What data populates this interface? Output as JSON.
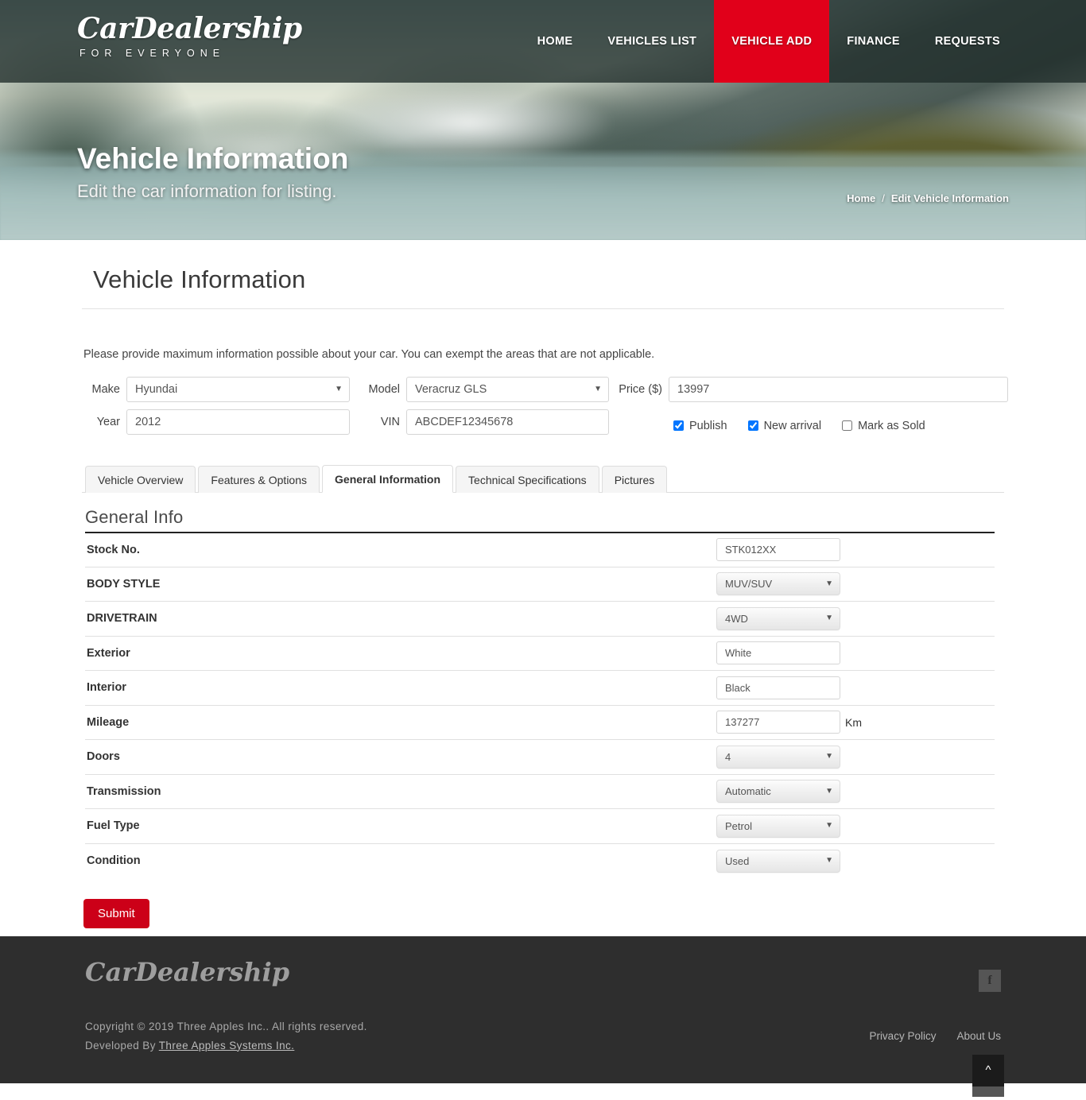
{
  "header": {
    "logo_main": "CarDealership",
    "logo_sub": "FOR EVERYONE",
    "nav": [
      {
        "label": "HOME",
        "active": false
      },
      {
        "label": "VEHICLES LIST",
        "active": false
      },
      {
        "label": "VEHICLE ADD",
        "active": true
      },
      {
        "label": "FINANCE",
        "active": false
      },
      {
        "label": "REQUESTS",
        "active": false
      }
    ],
    "accent_color": "#e1001a"
  },
  "hero": {
    "title": "Vehicle Information",
    "subtitle": "Edit the car information for listing.",
    "breadcrumb_home": "Home",
    "breadcrumb_sep": "/",
    "breadcrumb_current": "Edit Vehicle Information"
  },
  "page": {
    "title": "Vehicle Information",
    "intro": "Please provide maximum information possible about your car. You can exempt the areas that are not applicable."
  },
  "form": {
    "make_label": "Make",
    "make_value": "Hyundai",
    "model_label": "Model",
    "model_value": "Veracruz GLS",
    "price_label": "Price ($)",
    "price_value": "13997",
    "year_label": "Year",
    "year_value": "2012",
    "vin_label": "VIN",
    "vin_value": "ABCDEF12345678",
    "checkboxes": [
      {
        "label": "Publish",
        "checked": true
      },
      {
        "label": "New arrival",
        "checked": true
      },
      {
        "label": "Mark as Sold",
        "checked": false
      }
    ]
  },
  "tabs": [
    {
      "label": "Vehicle Overview",
      "active": false
    },
    {
      "label": "Features & Options",
      "active": false
    },
    {
      "label": "General Information",
      "active": true
    },
    {
      "label": "Technical Specifications",
      "active": false
    },
    {
      "label": "Pictures",
      "active": false
    }
  ],
  "general_info": {
    "section_title": "General Info",
    "rows": [
      {
        "label": "Stock No.",
        "value": "STK012XX",
        "type": "text",
        "unit": ""
      },
      {
        "label": "BODY STYLE",
        "value": "MUV/SUV",
        "type": "select",
        "unit": ""
      },
      {
        "label": "DRIVETRAIN",
        "value": "4WD",
        "type": "select",
        "unit": ""
      },
      {
        "label": "Exterior",
        "value": "White",
        "type": "text",
        "unit": ""
      },
      {
        "label": "Interior",
        "value": "Black",
        "type": "text",
        "unit": ""
      },
      {
        "label": "Mileage",
        "value": "137277",
        "type": "text",
        "unit": "Km"
      },
      {
        "label": "Doors",
        "value": "4",
        "type": "select",
        "unit": ""
      },
      {
        "label": "Transmission",
        "value": "Automatic",
        "type": "select",
        "unit": ""
      },
      {
        "label": "Fuel Type",
        "value": "Petrol",
        "type": "select",
        "unit": ""
      },
      {
        "label": "Condition",
        "value": "Used",
        "type": "select",
        "unit": ""
      }
    ]
  },
  "submit_label": "Submit",
  "scroll_top_icon": "chevron-up",
  "footer": {
    "logo": "CarDealership",
    "copyright": "Copyright © 2019 Three Apples Inc.. All rights reserved.",
    "developed_prefix": "Developed By ",
    "developed_link": "Three Apples Systems Inc.",
    "social_icon": "f",
    "links": [
      {
        "label": "Privacy Policy"
      },
      {
        "label": "About Us"
      }
    ]
  }
}
